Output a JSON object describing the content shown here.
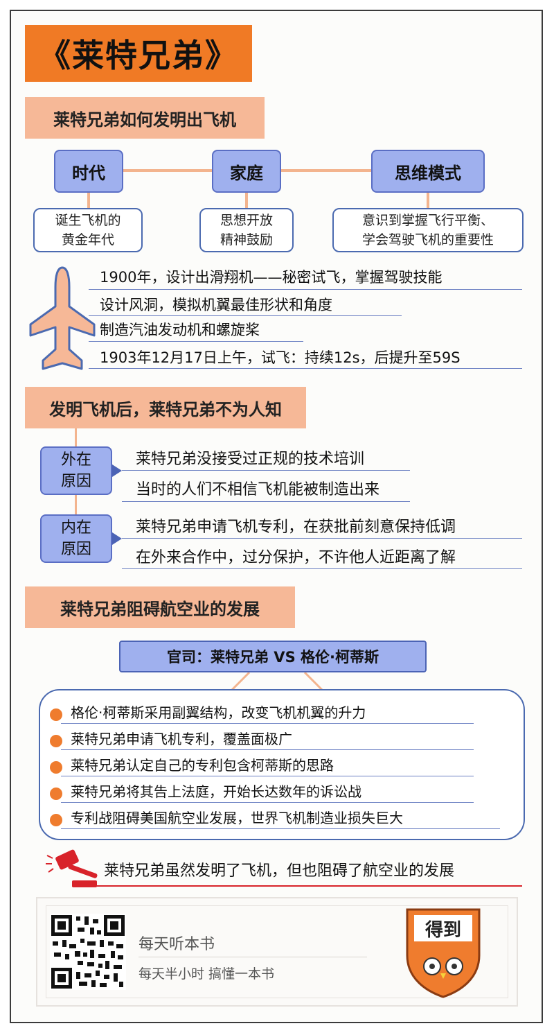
{
  "title": "《莱特兄弟》",
  "section1": {
    "heading": "莱特兄弟如何发明出飞机",
    "nodes": [
      {
        "label": "时代",
        "desc": [
          "诞生飞机的",
          "黄金年代"
        ]
      },
      {
        "label": "家庭",
        "desc": [
          "思想开放",
          "精神鼓励"
        ]
      },
      {
        "label": "思维模式",
        "desc": [
          "意识到掌握飞行平衡、",
          "学会驾驶飞机的重要性"
        ]
      }
    ],
    "timeline": [
      "1900年，设计出滑翔机——秘密试飞，掌握驾驶技能",
      "设计风洞，模拟机翼最佳形状和角度",
      "制造汽油发动机和螺旋桨",
      "1903年12月17日上午，试飞：持续12s，后提升至59S"
    ]
  },
  "section2": {
    "heading": "发明飞机后，莱特兄弟不为人知",
    "external": {
      "label": [
        "外在",
        "原因"
      ],
      "items": [
        "莱特兄弟没接受过正规的技术培训",
        "当时的人们不相信飞机能被制造出来"
      ]
    },
    "internal": {
      "label": [
        "内在",
        "原因"
      ],
      "items": [
        "莱特兄弟申请飞机专利，在获批前刻意保持低调",
        "在外来合作中，过分保护，不许他人近距离了解"
      ]
    }
  },
  "section3": {
    "heading": "莱特兄弟阻碍航空业的发展",
    "lawsuit": "官司：莱特兄弟 VS 格伦·柯蒂斯",
    "items": [
      "格伦·柯蒂斯采用副翼结构，改变飞机机翼的升力",
      "莱特兄弟申请飞机专利，覆盖面极广",
      "莱特兄弟认定自己的专利包含柯蒂斯的思路",
      "莱特兄弟将其告上法庭，开始长达数年的诉讼战",
      "专利战阻碍美国航空业发展，世界飞机制造业损失巨大"
    ],
    "conclusion": "莱特兄弟虽然发明了飞机，但也阻碍了航空业的发展"
  },
  "footer": {
    "app_name": "每天听本书",
    "tagline": "每天半小时  搞懂一本书",
    "logo_text": "得到"
  },
  "colors": {
    "orange": "#f07a25",
    "peach": "#f6b897",
    "blue": "#9fb0ee",
    "navy": "#4b63b5"
  }
}
